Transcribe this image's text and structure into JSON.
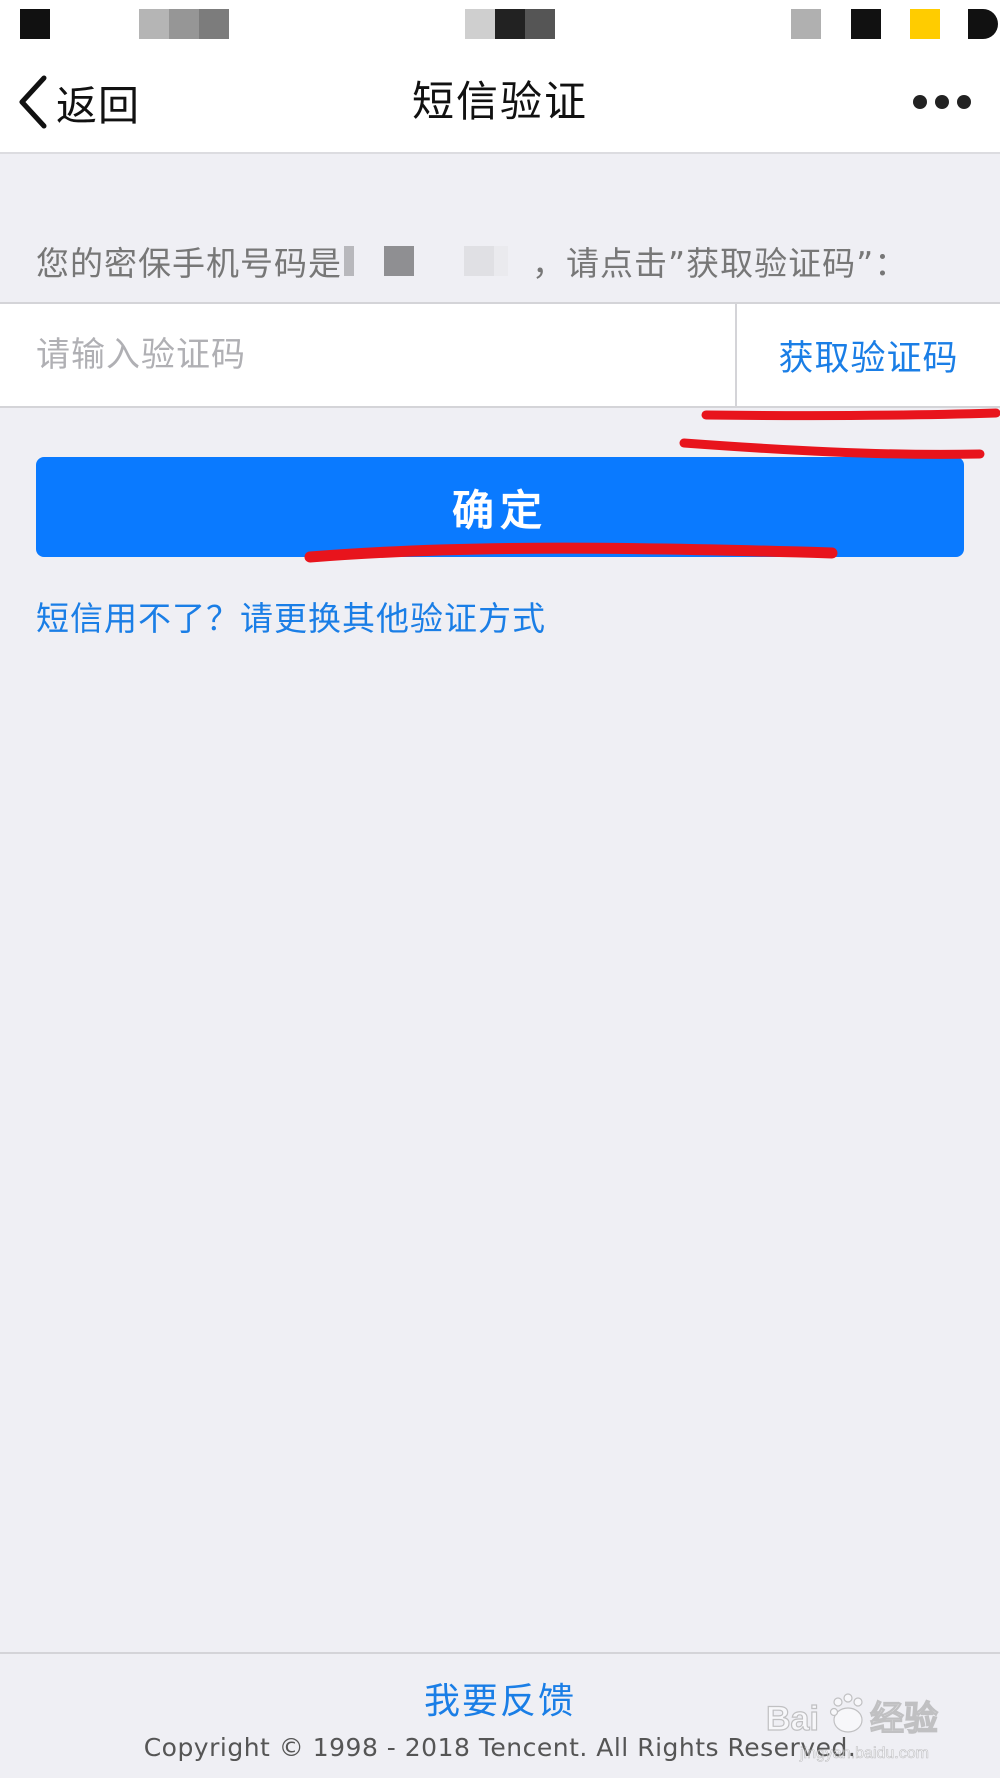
{
  "nav": {
    "back_label": "返回",
    "title": "短信验证",
    "more_icon": "more-horizontal-icon",
    "back_icon": "chevron-left-icon"
  },
  "prompt": {
    "prefix": "您的密保手机号码是",
    "suffix": "，请点击”获取验证码”："
  },
  "code_input": {
    "placeholder": "请输入验证码",
    "value": ""
  },
  "get_code_label": "获取验证码",
  "confirm_label": "确定",
  "alt_method_link": "短信用不了？请更换其他验证方式",
  "footer": {
    "feedback_label": "我要反馈",
    "copyright": "Copyright © 1998 - 2018 Tencent. All Rights Reserved."
  },
  "watermark": {
    "text": "Baidu经验",
    "subtext": "jingyan.baidu.com"
  },
  "colors": {
    "accent": "#1a7ee6",
    "button": "#0a7aff",
    "background": "#efeff4",
    "annotation": "#e8141c"
  }
}
